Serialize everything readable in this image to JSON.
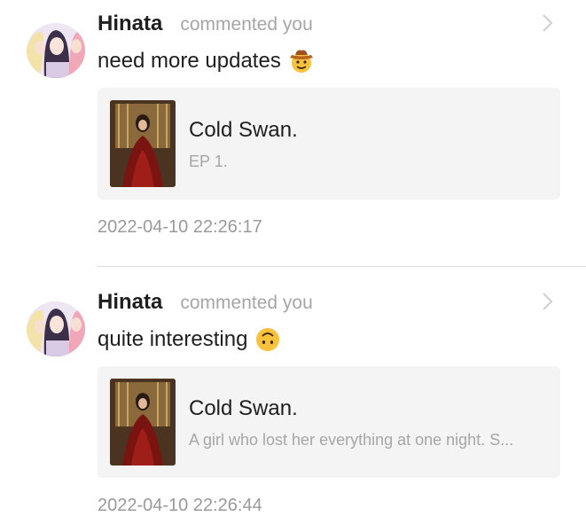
{
  "comments": [
    {
      "avatar_icon": "user-avatar-icon",
      "username": "Hinata",
      "action": "commented you",
      "text": "need more updates",
      "emoji": "cowboy-face-emoji",
      "card": {
        "title": "Cold Swan.",
        "subtitle": "EP 1."
      },
      "timestamp": "2022-04-10 22:26:17"
    },
    {
      "avatar_icon": "user-avatar-icon",
      "username": "Hinata",
      "action": "commented you",
      "text": "quite interesting",
      "emoji": "upside-down-face-emoji",
      "card": {
        "title": "Cold Swan.",
        "subtitle": "A girl who lost her everything at one night. S..."
      },
      "timestamp": "2022-04-10 22:26:44"
    }
  ],
  "colors": {
    "text_primary": "#1f1f1f",
    "text_secondary": "#a6a6a6",
    "card_background": "#f4f4f4",
    "divider": "#dcdcdc",
    "emoji_yellow": "#f9c23c"
  }
}
